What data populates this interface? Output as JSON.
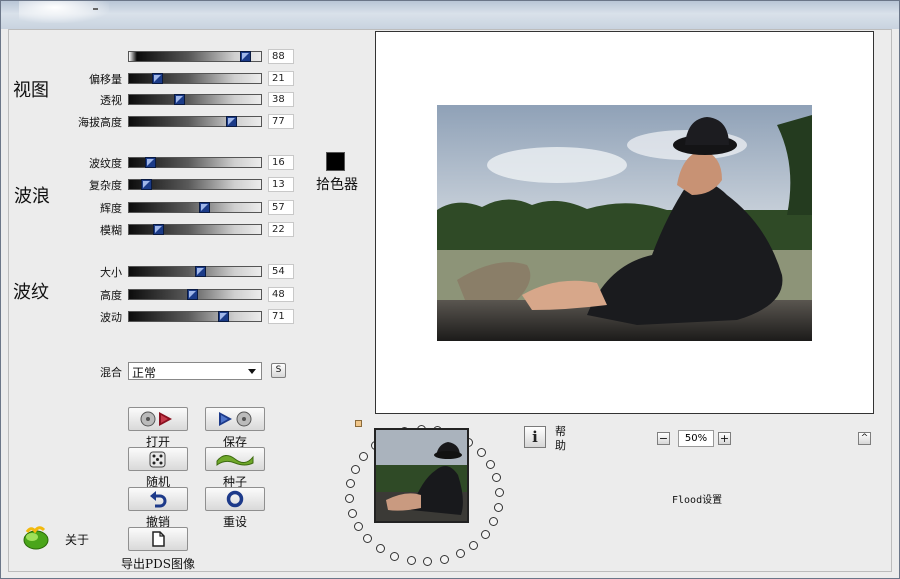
{
  "view_group": {
    "title": "视图",
    "sliders": [
      {
        "label": "",
        "value": 88
      },
      {
        "label": "偏移量",
        "value": 21
      },
      {
        "label": "透视",
        "value": 38
      },
      {
        "label": "海拔高度",
        "value": 77
      }
    ]
  },
  "wave_group": {
    "title": "波浪",
    "sliders": [
      {
        "label": "波纹度",
        "value": 16
      },
      {
        "label": "复杂度",
        "value": 13
      },
      {
        "label": "辉度",
        "value": 57
      },
      {
        "label": "模糊",
        "value": 22
      }
    ]
  },
  "ripple_group": {
    "title": "波纹",
    "sliders": [
      {
        "label": "大小",
        "value": 54
      },
      {
        "label": "高度",
        "value": 48
      },
      {
        "label": "波动",
        "value": 71
      }
    ]
  },
  "color_picker": {
    "label": "拾色器",
    "color": "#000000"
  },
  "blend": {
    "label": "混合",
    "selected": "正常",
    "s_button": "S"
  },
  "buttons": {
    "open": "打开",
    "save": "保存",
    "random": "随机",
    "seed": "种子",
    "undo": "撤销",
    "reset": "重设",
    "export": "导出PDS图像"
  },
  "about": {
    "label": "关于"
  },
  "help": {
    "label": "帮助",
    "icon": "info-icon"
  },
  "zoom": {
    "minus": "−",
    "value": "50%",
    "plus": "+"
  },
  "footer_text": "Flood设置",
  "collapse_button": "^"
}
